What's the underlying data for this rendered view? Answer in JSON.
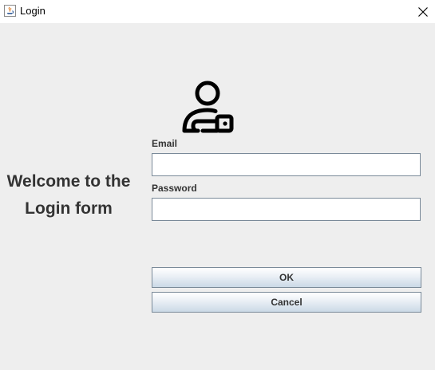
{
  "window": {
    "title": "Login"
  },
  "welcome": {
    "line1": "Welcome to the",
    "line2": "Login form"
  },
  "form": {
    "email_label": "Email",
    "email_value": "",
    "password_label": "Password",
    "password_value": ""
  },
  "buttons": {
    "ok_label": "OK",
    "cancel_label": "Cancel"
  },
  "icons": {
    "app": "java-app-icon",
    "close": "close-icon",
    "header": "user-key-icon"
  },
  "colors": {
    "background": "#eeeeee",
    "titlebar": "#ffffff",
    "text": "#333333",
    "input_border": "#7a8a99"
  }
}
